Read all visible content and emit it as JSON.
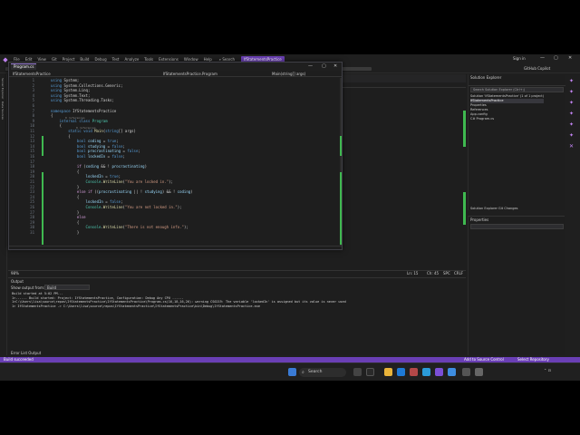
{
  "menu": {
    "logo_icon": "vs-logo-icon",
    "items": [
      "File",
      "Edit",
      "View",
      "Git",
      "Project",
      "Build",
      "Debug",
      "Test",
      "Analyze",
      "Tools",
      "Extensions",
      "Window",
      "Help"
    ],
    "search_label": "Search",
    "solution_title": "IfStatementsPractice",
    "sign_in": "Sign in",
    "minimize": "—",
    "maximize": "▢",
    "close": "✕"
  },
  "toolbar": {
    "config": "Debug",
    "copilot": "GitHub Copilot"
  },
  "left_strip": [
    "Server Explorer",
    "Data Sources"
  ],
  "floating_editor": {
    "tab": "Program.cs",
    "nav_project": "IfStatementsPractice",
    "nav_class": "IfStatementsPractice.Program",
    "nav_member": "Main(string[] args)",
    "lines": [
      {
        "n": "1",
        "segs": [
          [
            "kw",
            "using "
          ],
          [
            "pl",
            "System;"
          ]
        ]
      },
      {
        "n": "2",
        "segs": [
          [
            "kw",
            "using "
          ],
          [
            "pl",
            "System.Collections.Generic;"
          ]
        ]
      },
      {
        "n": "3",
        "segs": [
          [
            "kw",
            "using "
          ],
          [
            "pl",
            "System.Linq;"
          ]
        ]
      },
      {
        "n": "4",
        "segs": [
          [
            "kw",
            "using "
          ],
          [
            "pl",
            "System.Text;"
          ]
        ]
      },
      {
        "n": "5",
        "segs": [
          [
            "kw",
            "using "
          ],
          [
            "pl",
            "System.Threading.Tasks;"
          ]
        ]
      },
      {
        "n": "6",
        "segs": []
      },
      {
        "n": "7",
        "segs": [
          [
            "kw",
            "namespace "
          ],
          [
            "pl",
            "IfStatementsPractice"
          ]
        ]
      },
      {
        "n": "8",
        "segs": [
          [
            "pl",
            "{"
          ]
        ]
      },
      {
        "n": "9",
        "segs": [
          [
            "pl",
            "    "
          ],
          [
            "kw",
            "internal class "
          ],
          [
            "ty",
            "Program"
          ]
        ]
      },
      {
        "n": "10",
        "segs": [
          [
            "pl",
            "    {"
          ]
        ]
      },
      {
        "n": "11",
        "segs": [
          [
            "pl",
            "        "
          ],
          [
            "kw",
            "static void "
          ],
          [
            "fn",
            "Main"
          ],
          [
            "pl",
            "("
          ],
          [
            "kw",
            "string"
          ],
          [
            "pl",
            "[] args)"
          ]
        ]
      },
      {
        "n": "12",
        "segs": [
          [
            "pl",
            "        {"
          ]
        ]
      },
      {
        "n": "13",
        "segs": [
          [
            "pl",
            "            "
          ],
          [
            "kw",
            "bool "
          ],
          [
            "id",
            "coding"
          ],
          [
            "pl",
            " = "
          ],
          [
            "kw",
            "true"
          ],
          [
            "pl",
            ";"
          ]
        ]
      },
      {
        "n": "14",
        "segs": [
          [
            "pl",
            "            "
          ],
          [
            "kw",
            "bool "
          ],
          [
            "id",
            "studying"
          ],
          [
            "pl",
            " = "
          ],
          [
            "kw",
            "false"
          ],
          [
            "pl",
            ";"
          ]
        ]
      },
      {
        "n": "15",
        "segs": [
          [
            "pl",
            "            "
          ],
          [
            "kw",
            "bool "
          ],
          [
            "id",
            "procrastinating"
          ],
          [
            "pl",
            " = "
          ],
          [
            "kw",
            "false"
          ],
          [
            "pl",
            ";"
          ]
        ]
      },
      {
        "n": "16",
        "segs": [
          [
            "pl",
            "            "
          ],
          [
            "kw",
            "bool "
          ],
          [
            "id",
            "lockedIn"
          ],
          [
            "pl",
            " = "
          ],
          [
            "kw",
            "false"
          ],
          [
            "pl",
            ";"
          ]
        ]
      },
      {
        "n": "17",
        "segs": []
      },
      {
        "n": "18",
        "segs": [
          [
            "pl",
            "            "
          ],
          [
            "cf",
            "if "
          ],
          [
            "pl",
            "("
          ],
          [
            "id",
            "coding"
          ],
          [
            "pl",
            " && ! "
          ],
          [
            "id",
            "procrastinating"
          ],
          [
            "pl",
            ")"
          ]
        ]
      },
      {
        "n": "19",
        "segs": [
          [
            "pl",
            "            {"
          ]
        ]
      },
      {
        "n": "20",
        "segs": [
          [
            "pl",
            "                "
          ],
          [
            "id",
            "lockedIn"
          ],
          [
            "pl",
            " = "
          ],
          [
            "kw",
            "true"
          ],
          [
            "pl",
            ";"
          ]
        ]
      },
      {
        "n": "21",
        "segs": [
          [
            "pl",
            "                "
          ],
          [
            "ty",
            "Console"
          ],
          [
            "pl",
            "."
          ],
          [
            "fn",
            "WriteLine"
          ],
          [
            "pl",
            "("
          ],
          [
            "st",
            "\"You are locked in.\""
          ],
          [
            "pl",
            ");"
          ]
        ]
      },
      {
        "n": "22",
        "segs": [
          [
            "pl",
            "            }"
          ]
        ]
      },
      {
        "n": "23",
        "segs": [
          [
            "pl",
            "            "
          ],
          [
            "cf",
            "else if "
          ],
          [
            "pl",
            "(("
          ],
          [
            "id",
            "procrastinating"
          ],
          [
            "pl",
            " || ! "
          ],
          [
            "id",
            "studying"
          ],
          [
            "pl",
            ") && ! "
          ],
          [
            "id",
            "coding"
          ],
          [
            "pl",
            ")"
          ]
        ]
      },
      {
        "n": "24",
        "segs": [
          [
            "pl",
            "            {"
          ]
        ]
      },
      {
        "n": "25",
        "segs": [
          [
            "pl",
            "                "
          ],
          [
            "id",
            "lockedIn"
          ],
          [
            "pl",
            " = "
          ],
          [
            "kw",
            "false"
          ],
          [
            "pl",
            ";"
          ]
        ]
      },
      {
        "n": "26",
        "segs": [
          [
            "pl",
            "                "
          ],
          [
            "ty",
            "Console"
          ],
          [
            "pl",
            "."
          ],
          [
            "fn",
            "WriteLine"
          ],
          [
            "pl",
            "("
          ],
          [
            "st",
            "\"You are not locked in.\""
          ],
          [
            "pl",
            ");"
          ]
        ]
      },
      {
        "n": "27",
        "segs": [
          [
            "pl",
            "            }"
          ]
        ]
      },
      {
        "n": "28",
        "segs": [
          [
            "pl",
            "            "
          ],
          [
            "cf",
            "else"
          ]
        ]
      },
      {
        "n": "29",
        "segs": [
          [
            "pl",
            "            {"
          ]
        ]
      },
      {
        "n": "30",
        "segs": [
          [
            "pl",
            "                "
          ],
          [
            "ty",
            "Console"
          ],
          [
            "pl",
            "."
          ],
          [
            "fn",
            "WriteLine"
          ],
          [
            "pl",
            "("
          ],
          [
            "st",
            "\"There is not enough info.\""
          ],
          [
            "pl",
            ");"
          ]
        ]
      },
      {
        "n": "31",
        "segs": [
          [
            "pl",
            "            }"
          ]
        ]
      }
    ],
    "hints": {
      "refs0": "0 references",
      "refs1": "0 references"
    }
  },
  "editor_status": {
    "zoom": "98%",
    "position": "Ln: 15",
    "col": "Ch: 45",
    "enc": "SPC",
    "eol": "CRLF"
  },
  "output": {
    "title": "Output",
    "show_from_label": "Show output from:",
    "show_from_value": "Build",
    "lines": [
      "Build started at 5:02 PM...",
      "1>------ Build started: Project: IfStatementsPractice, Configuration: Debug Any CPU ------",
      "1>C:\\Users\\lisa\\source\\repos\\IfStatementsPractice\\IfStatementsPractice\\Program.cs(16,18,16,26): warning CS0219: The variable 'lockedIn' is assigned but its value is never used",
      "1>  IfStatementsPractice -> C:\\Users\\lisa\\source\\repos\\IfStatementsPractice\\IfStatementsPractice\\bin\\Debug\\IfStatementsPractice.exe"
    ],
    "tabs": "Error List   Output"
  },
  "solution_explorer": {
    "title": "Solution Explorer",
    "search_placeholder": "Search Solution Explorer (Ctrl+;)",
    "tree": [
      "Solution 'IfStatementsPractice' (1 of 1 project)",
      "  IfStatementsPractice",
      "    Properties",
      "    References",
      "    App.config",
      "    C# Program.cs"
    ],
    "tabs": "Solution Explorer   Git Changes"
  },
  "properties": {
    "title": "Properties"
  },
  "status_bar": {
    "left": "Build succeeded",
    "source_control": "Add to Source Control",
    "repo": "Select Repository"
  },
  "taskbar": {
    "search": "Search",
    "search_icon": "search-icon"
  },
  "colors": {
    "accent": "#6a3fb5",
    "change_bar": "#3fb950"
  }
}
